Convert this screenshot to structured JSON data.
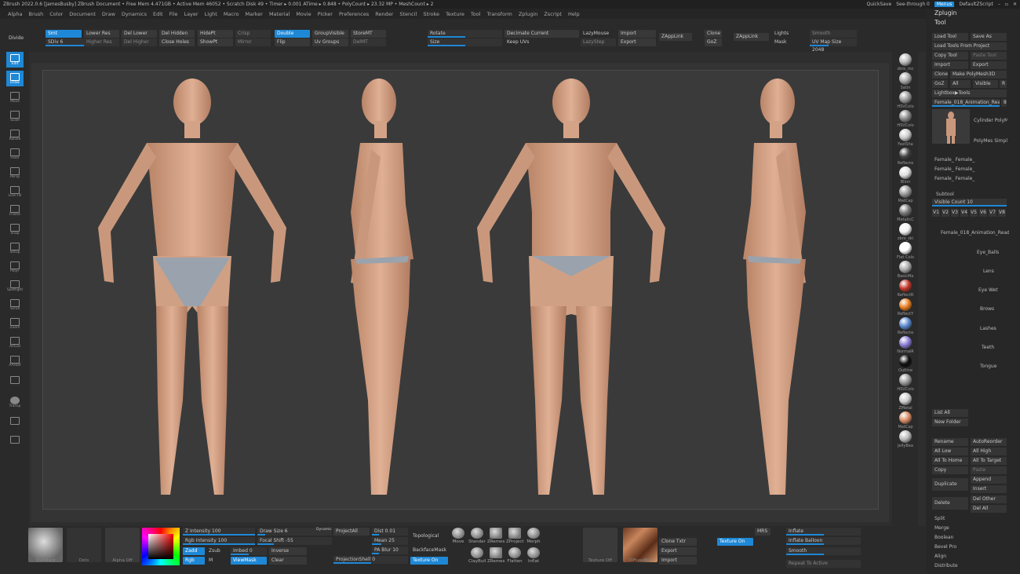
{
  "titlebar": {
    "title": "ZBrush 2022.0.6 [JamesBusby]    ZBrush Document    • Free Mem 4.471GB • Active Mem 46052 • Scratch Disk 49 • Timer ▸ 0.001 ATime ▸ 0.848 • PolyCount ▸ 23.32 MP • MeshCount ▸ 2",
    "quicksave": "QuickSave",
    "seethrough": "See-through  0",
    "menus": "Menus",
    "script": "DefaultZScript"
  },
  "menubar": [
    "Alpha",
    "Brush",
    "Color",
    "Document",
    "Draw",
    "Dynamics",
    "Edit",
    "File",
    "Layer",
    "Light",
    "Macro",
    "Marker",
    "Material",
    "Movie",
    "Picker",
    "Preferences",
    "Render",
    "Stencil",
    "Stroke",
    "Texture",
    "Tool",
    "Transform",
    "Zplugin",
    "Zscript",
    "Help"
  ],
  "top": {
    "divide": "Divide",
    "smt": "Smt",
    "sdiv": "SDiv 6",
    "lower_res": "Lower Res",
    "higher_res": "Higher Res",
    "del_lower": "Del Lower",
    "del_higher": "Del Higher",
    "del_hidden": "Del Hidden",
    "close_holes": "Close Holes",
    "hidept": "HidePt",
    "showpt": "ShowPt",
    "crisp": "Crisp",
    "mirror": "Mirror",
    "double": "Double",
    "flip": "Flip",
    "groupvisible": "GroupVisible",
    "uv_groups": "Uv Groups",
    "storemt": "StoreMT",
    "delmt": "DelMT",
    "rotate": "Rotate",
    "size": "Size",
    "decimate": "Decimate Current",
    "keep_uvs": "Keep UVs",
    "lazymouse": "LazyMouse",
    "lazystep": "LazyStep",
    "import": "Import",
    "export": "Export",
    "zapplink": "ZAppLink",
    "clone": "Clone",
    "goz": "GoZ",
    "zapplink2": "ZAppLink",
    "lights": "Lights",
    "mask": "Mask",
    "smooth": "Smooth",
    "uvmap": "UV Map Size 2048"
  },
  "lefttools": [
    "Edit",
    "Draw",
    "Move",
    "Scale",
    "Rotate",
    "Floor",
    "Persp",
    "Line Fill",
    "Frame",
    "Snap",
    "Setup",
    "PolyF",
    "Spotlight",
    "Scroll",
    "Zoom",
    "Actual",
    "AAHalf",
    "",
    "Transp",
    "",
    ""
  ],
  "materials": [
    {
      "name": "zbro_mc",
      "c": "#bbb"
    },
    {
      "name": "Satin",
      "c": "#aaa"
    },
    {
      "name": "HSVColo",
      "c": "#999"
    },
    {
      "name": "HSVColo",
      "c": "#888"
    },
    {
      "name": "FastSha",
      "c": "#ccc"
    },
    {
      "name": "Reflecte",
      "c": "#444"
    },
    {
      "name": "Blinn",
      "c": "#ddd"
    },
    {
      "name": "MatCap",
      "c": "#999"
    },
    {
      "name": "MetalicC",
      "c": "#777"
    },
    {
      "name": "zbro_ski",
      "c": "#f2f2f2"
    },
    {
      "name": "Flat Colo",
      "c": "#ffffff"
    },
    {
      "name": "BasicMa",
      "c": "#aaa"
    },
    {
      "name": "ReflectR",
      "c": "#c0392b"
    },
    {
      "name": "ReflectY",
      "c": "#e67e22"
    },
    {
      "name": "Reflecte",
      "c": "#5b8bd0"
    },
    {
      "name": "NormalR",
      "c": "#8c7cd6"
    },
    {
      "name": "Outline",
      "c": "#111"
    },
    {
      "name": "HSVColo",
      "c": "#999"
    },
    {
      "name": "ZMetal",
      "c": "#ccc"
    },
    {
      "name": "MatCap",
      "c": "#d98c66"
    },
    {
      "name": "JellyBea",
      "c": "#bbb"
    }
  ],
  "right": {
    "zplugin": "Zplugin",
    "tool": "Tool",
    "load_tool": "Load Tool",
    "save_as": "Save As",
    "load_tools_project": "Load Tools From Project",
    "copy_tool": "Copy Tool",
    "paste_tool": "Paste Tool",
    "import": "Import",
    "export": "Export",
    "clone": "Clone",
    "make_polymesh": "Make PolyMesh3D",
    "goz": "GoZ",
    "all": "All",
    "visible": "Visible",
    "r": "R",
    "lightbox": "Lightbox▶Tools",
    "current_tool": "Female_018_Animation_Read",
    "slider_val": "8",
    "thumbs": [
      "Cylinder PolyMe",
      "PolyMes SimpleB",
      "Female_  Female_",
      "Female_  Female_",
      "Female_  Female_"
    ],
    "subtool": "Subtool",
    "visible_count": "Visible Count 10",
    "vtabs": [
      "V1",
      "V2",
      "V3",
      "V4",
      "V5",
      "V6",
      "V7",
      "V8"
    ],
    "subtools": [
      "Female_018_Animation_Ready",
      "Eye_Balls",
      "Lens",
      "Eye Wet",
      "Brows",
      "Lashes",
      "Teeth",
      "Tongue"
    ],
    "list_all": "List All",
    "new_folder": "New Folder",
    "rename": "Rename",
    "autoreorder": "AutoReorder",
    "all_low": "All Low",
    "all_high": "All High",
    "all_to_home": "All To Home",
    "all_to_target": "All To Target",
    "copy": "Copy",
    "paste": "Paste",
    "duplicate": "Duplicate",
    "append": "Append",
    "insert": "Insert",
    "delete": "Delete",
    "del_other": "Del Other",
    "del_all": "Del All",
    "split": "Split",
    "merge": "Merge",
    "boolean": "Boolean",
    "bevel_pro": "Bevel Pro",
    "align": "Align",
    "distribute": "Distribute"
  },
  "bottom": {
    "standard": "Standard",
    "dots": "Dots",
    "alpha_off": "Alpha Off",
    "z_intensity": "Z Intensity 100",
    "rgb_intensity": "Rgb Intensity 100",
    "zadd": "Zadd",
    "zsub": "Zsub",
    "rgb": "Rgb",
    "m": "M",
    "mrgb": "Mrgb",
    "draw_size": "Draw Size 6",
    "dynamic": "Dynamic",
    "focal_shift": "Focal Shift -55",
    "imbed": "Imbed 0",
    "inverse": "Inverse",
    "viewmask": "ViewMask",
    "clear": "Clear",
    "projectall": "ProjectAll",
    "dist": "Dist 0.01",
    "mean": "Mean 25",
    "pa_blur": "PA Blur 10",
    "topological": "Topological",
    "backfacemask": "BackfaceMask",
    "projectionshell": "ProjectionShell 0",
    "texture_on": "Texture On",
    "brushes": [
      "Move",
      "Standar",
      "ZRemes",
      "ZProject",
      "Morph",
      "ClayBuil",
      "ZRemes",
      "Flatten",
      "Inflat"
    ],
    "texture_off": "Texture Off",
    "diffusebk": "DiffuseBk1",
    "clone_txtr": "Clone Txtr",
    "export": "Export",
    "import": "Import",
    "texture_on2": "Texture On",
    "mrs": "MRS",
    "inflate": "Inflate",
    "inflate_balloon": "Inflate Balloon",
    "smooth": "Smooth",
    "repeat_active": "Repeat To Active"
  },
  "colors": {
    "accent": "#1e88d6",
    "skin": "#d9a88a",
    "underwear": "#9aa3ad"
  }
}
